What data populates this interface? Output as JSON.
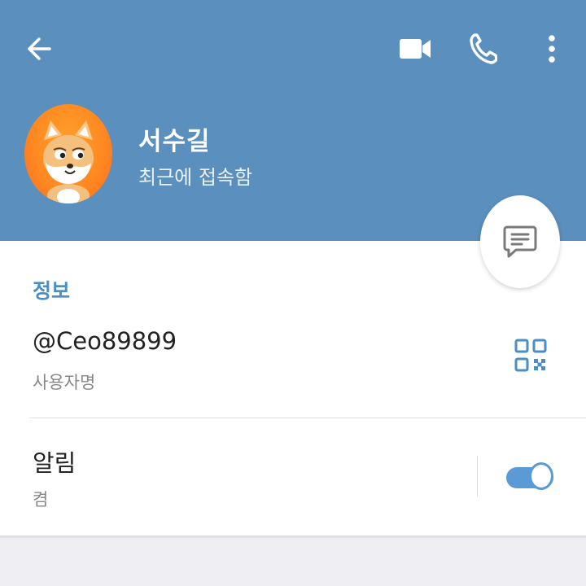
{
  "header": {
    "name": "서수길",
    "status": "최근에 접속함",
    "background_color": "#5b8fbd",
    "icons": {
      "back": "arrow-left-icon",
      "video": "video-camera-icon",
      "call": "phone-icon",
      "more": "more-vertical-icon",
      "message": "message-icon"
    }
  },
  "info": {
    "section_title": "정보",
    "username": "@Ceo89899",
    "username_label": "사용자명",
    "qr_icon": "qr-code-icon"
  },
  "notifications": {
    "title": "알림",
    "value": "켬",
    "enabled": true
  },
  "colors": {
    "accent": "#4a8ec4",
    "toggle": "#5a9bd5",
    "avatar": "#ff8a22"
  }
}
